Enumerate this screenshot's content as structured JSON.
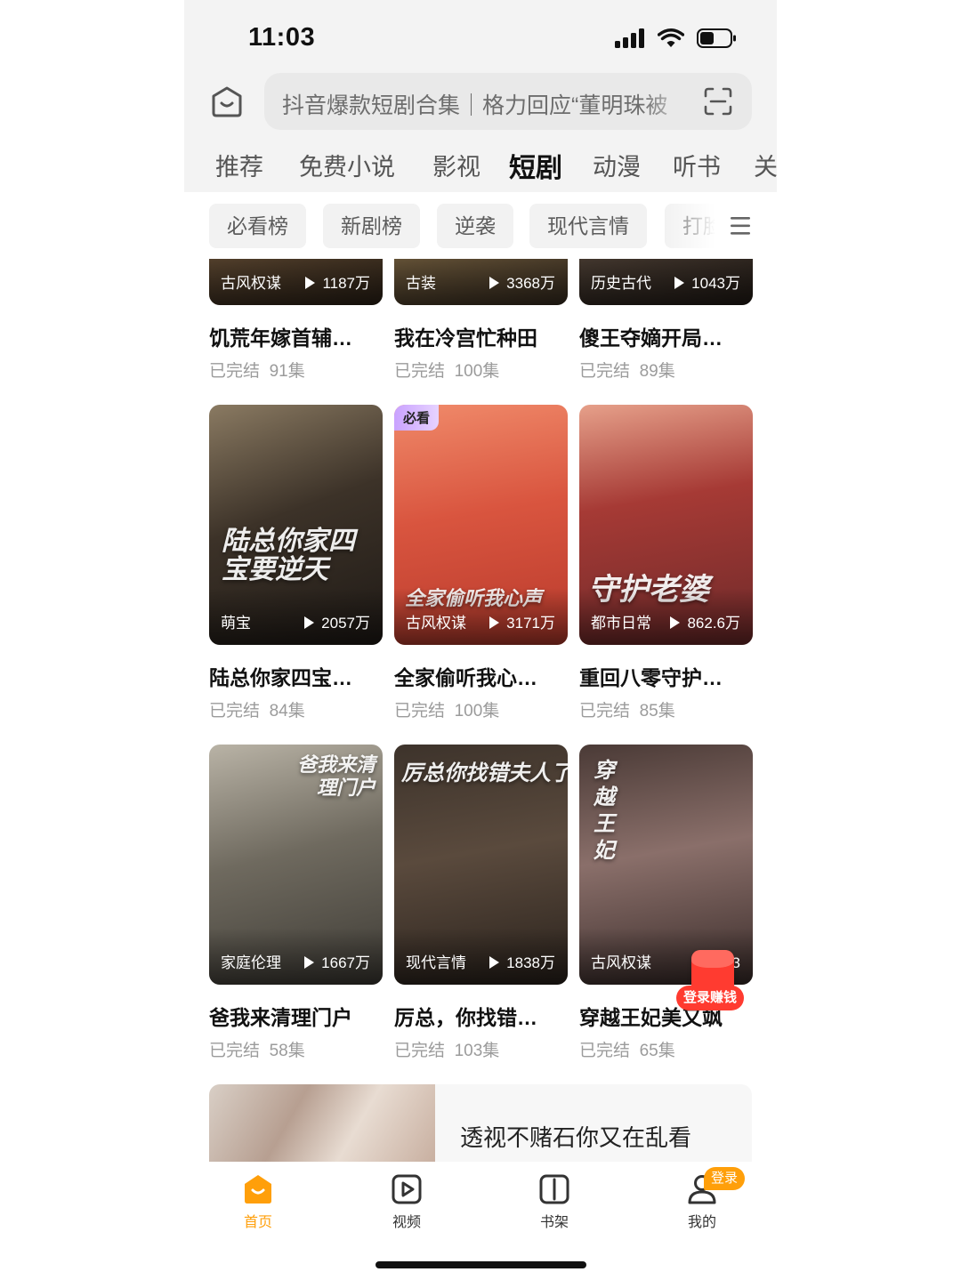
{
  "status_bar": {
    "time": "11:03"
  },
  "search": {
    "text": "抖音爆款短剧合集｜格力回应“董明珠被"
  },
  "tabs": [
    {
      "label": "推荐"
    },
    {
      "label": "免费小说"
    },
    {
      "label": "影视"
    },
    {
      "label": "短剧"
    },
    {
      "label": "动漫"
    },
    {
      "label": "听书"
    },
    {
      "label": "关"
    }
  ],
  "active_tab": "短剧",
  "chips": [
    {
      "label": "必看榜"
    },
    {
      "label": "新剧榜"
    },
    {
      "label": "逆袭"
    },
    {
      "label": "现代言情"
    },
    {
      "label": "打脸"
    }
  ],
  "rows": [
    [
      {
        "genre": "古风权谋",
        "plays": "1187万",
        "title": "饥荒年嫁首辅…",
        "status": "已完结",
        "episodes": "91集"
      },
      {
        "genre": "古装",
        "plays": "3368万",
        "title": "我在冷宫忙种田",
        "status": "已完结",
        "episodes": "100集"
      },
      {
        "genre": "历史古代",
        "plays": "1043万",
        "title": "傻王夺嫡开局…",
        "status": "已完结",
        "episodes": "89集"
      }
    ],
    [
      {
        "genre": "萌宝",
        "plays": "2057万",
        "title": "陆总你家四宝…",
        "status": "已完结",
        "episodes": "84集",
        "poster_text": "陆总你家四宝要逆天"
      },
      {
        "genre": "古风权谋",
        "plays": "3171万",
        "title": "全家偷听我心…",
        "status": "已完结",
        "episodes": "100集",
        "badge": "必看",
        "poster_text": "全家偷听我心声"
      },
      {
        "genre": "都市日常",
        "plays": "862.6万",
        "title": "重回八零守护…",
        "status": "已完结",
        "episodes": "85集",
        "poster_text": "守护老婆"
      }
    ],
    [
      {
        "genre": "家庭伦理",
        "plays": "1667万",
        "title": "爸我来清理门户",
        "status": "已完结",
        "episodes": "58集",
        "poster_text": "爸我来清理门户"
      },
      {
        "genre": "现代言情",
        "plays": "1838万",
        "title": "厉总，你找错…",
        "status": "已完结",
        "episodes": "103集",
        "poster_text": "厉总你找错夫人了"
      },
      {
        "genre": "古风权谋",
        "plays": "3",
        "title": "穿越王妃美又飒",
        "status": "已完结",
        "episodes": "65集",
        "poster_text": "穿越王妃"
      }
    ]
  ],
  "banner": {
    "title": "透视不赌石你又在乱看",
    "subtitle": ""
  },
  "redpacket": {
    "label": "登录赚钱"
  },
  "bottom_nav": [
    {
      "label": "首页",
      "icon": "home-icon",
      "active": true
    },
    {
      "label": "视频",
      "icon": "video-play-icon"
    },
    {
      "label": "书架",
      "icon": "bookshelf-icon"
    },
    {
      "label": "我的",
      "icon": "profile-icon",
      "badge": "登录"
    }
  ],
  "colors": {
    "accent": "#ff9f0a",
    "red_packet": "#ff3b30",
    "badge_purple": "#c9a2ff"
  }
}
